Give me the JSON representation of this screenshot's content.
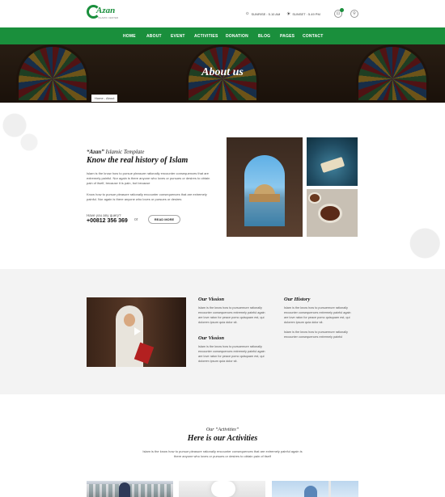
{
  "brand": {
    "name": "Azan",
    "tagline": "ISLAMIC CENTER"
  },
  "topbar": {
    "sunrise": "SUNRISE : 5.10 AM",
    "sunset": "SUNSET : 5.49 PM"
  },
  "nav": {
    "items": [
      "HOME",
      "ABOUT",
      "EVENT",
      "ACTIVITIES",
      "DONATION",
      "BLOG",
      "PAGES",
      "CONTACT"
    ]
  },
  "hero": {
    "title": "About us",
    "breadcrumb": "Home - About"
  },
  "about": {
    "subtitle_quote": "“Azan”",
    "subtitle_rest": " Islamic Template",
    "title": "Know the real history of Islam",
    "para1": "Islam is the know how to pursue pleasure rationally encounter consequences that are extremely painful. Nor again is there anyone who loves or pursues or desires to obtain pain of itself, because it is pain, but because",
    "para2": "Know how to pursue pleasure rationally encounter consequences that are extremely painful. Nor again is there anyone who loves or pursues or desires",
    "query_label": "Have you any query?",
    "phone": "+00812 356 369",
    "or": "or",
    "read_more": "READ MORE"
  },
  "vision": {
    "col1": [
      {
        "title": "Our Vission",
        "text": "Islam is the know how to pursuemure rationally encounter consequences extremely painful again are love raton for peace pomo quisquam est, qui dolorem ipsum quia dolor sit."
      },
      {
        "title": "Our Vission",
        "text": "Islam is the know how to pursuemure rationally encounter consequences extremely painful again are love raton for peace pomo quisquam est, qui dolorem ipsum quia dolor sit."
      }
    ],
    "col2": [
      {
        "title": "Our History",
        "text": "Islam is the know how to pursuemure rationally encounter consequences extremely painful again are love raton for peace pomo quisquam est, qui dolorem ipsum quia dolor sit.",
        "text2": "Islam is the know how to pursuemure rationally encounter consequences extremely painful"
      }
    ]
  },
  "activities": {
    "subtitle": "Our “Activities”",
    "title": "Here is our Activities",
    "text": "Islam is the know how to pursue pleasure rationally encounter consequences that are extremely painful again is there anyone who loves or pursues or desires to obtain pain of itself"
  },
  "colors": {
    "brand_green": "#1a8f3c",
    "band_gray": "#f3f3f3"
  },
  "icons": [
    "sunrise-icon",
    "sunset-icon",
    "cart-icon",
    "search-icon",
    "play-icon"
  ]
}
